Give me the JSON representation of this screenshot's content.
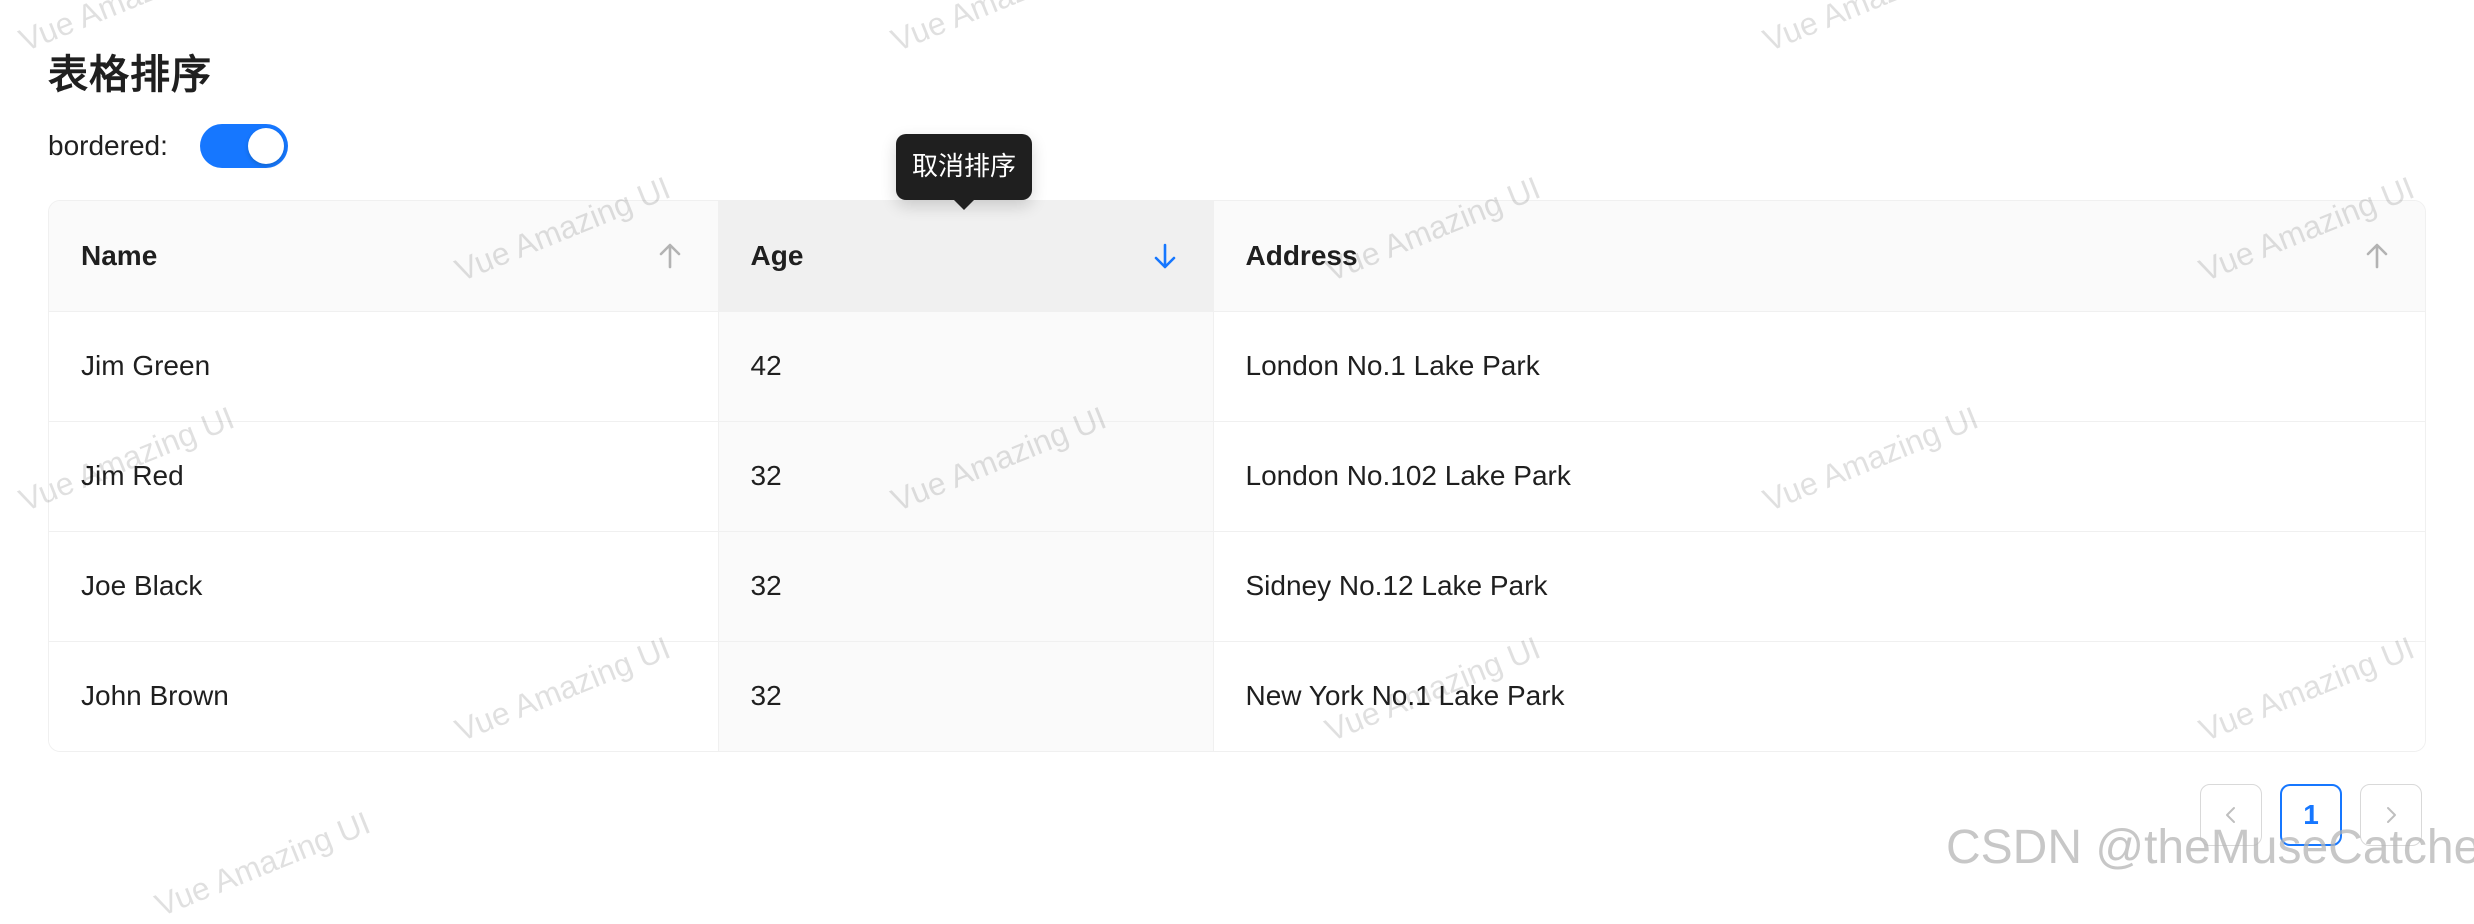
{
  "page": {
    "title": "表格排序"
  },
  "controls": {
    "bordered_label": "bordered:",
    "bordered_on": true
  },
  "table": {
    "columns": [
      {
        "label": "Name",
        "sort": "none",
        "sort_icon": "arrow-up-icon"
      },
      {
        "label": "Age",
        "sort": "descend",
        "sort_icon": "arrow-down-icon"
      },
      {
        "label": "Address",
        "sort": "none",
        "sort_icon": "arrow-up-icon"
      }
    ],
    "rows": [
      {
        "name": "Jim Green",
        "age": "42",
        "address": "London No.1 Lake Park"
      },
      {
        "name": "Jim Red",
        "age": "32",
        "address": "London No.102 Lake Park"
      },
      {
        "name": "Joe Black",
        "age": "32",
        "address": "Sidney No.12 Lake Park"
      },
      {
        "name": "John Brown",
        "age": "32",
        "address": "New York No.1 Lake Park"
      }
    ]
  },
  "tooltip": {
    "text": "取消排序"
  },
  "pagination": {
    "prev_icon": "chevron-left-icon",
    "current_page": "1",
    "next_icon": "chevron-right-icon"
  },
  "watermark": {
    "text": "Vue Amazing UI",
    "credit": "CSDN @theMuseCatcher"
  },
  "colors": {
    "accent": "#1677ff",
    "header_bg": "#fafafa",
    "sorted_header_bg": "#f0f0f0",
    "tooltip_bg": "#1f1f1f"
  }
}
